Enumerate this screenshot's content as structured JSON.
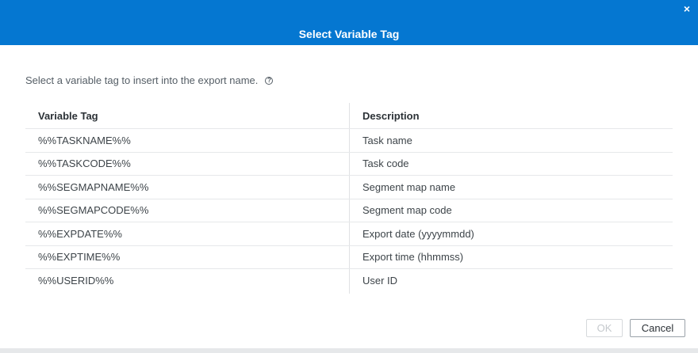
{
  "dialog": {
    "title": "Select Variable Tag",
    "close_glyph": "×",
    "instruction": "Select a variable tag to insert into the export name.",
    "help_glyph": "?",
    "buttons": {
      "ok": "OK",
      "cancel": "Cancel"
    },
    "colors": {
      "titlebar": "#0577d1",
      "text": "#3d4449"
    }
  },
  "table": {
    "headers": [
      "Variable Tag",
      "Description"
    ],
    "rows": [
      {
        "tag": "%%TASKNAME%%",
        "description": "Task name"
      },
      {
        "tag": "%%TASKCODE%%",
        "description": "Task code"
      },
      {
        "tag": "%%SEGMAPNAME%%",
        "description": "Segment map name"
      },
      {
        "tag": "%%SEGMAPCODE%%",
        "description": "Segment map code"
      },
      {
        "tag": "%%EXPDATE%%",
        "description": "Export date (yyyymmdd)"
      },
      {
        "tag": "%%EXPTIME%%",
        "description": "Export time (hhmmss)"
      },
      {
        "tag": "%%USERID%%",
        "description": "User ID"
      }
    ]
  }
}
